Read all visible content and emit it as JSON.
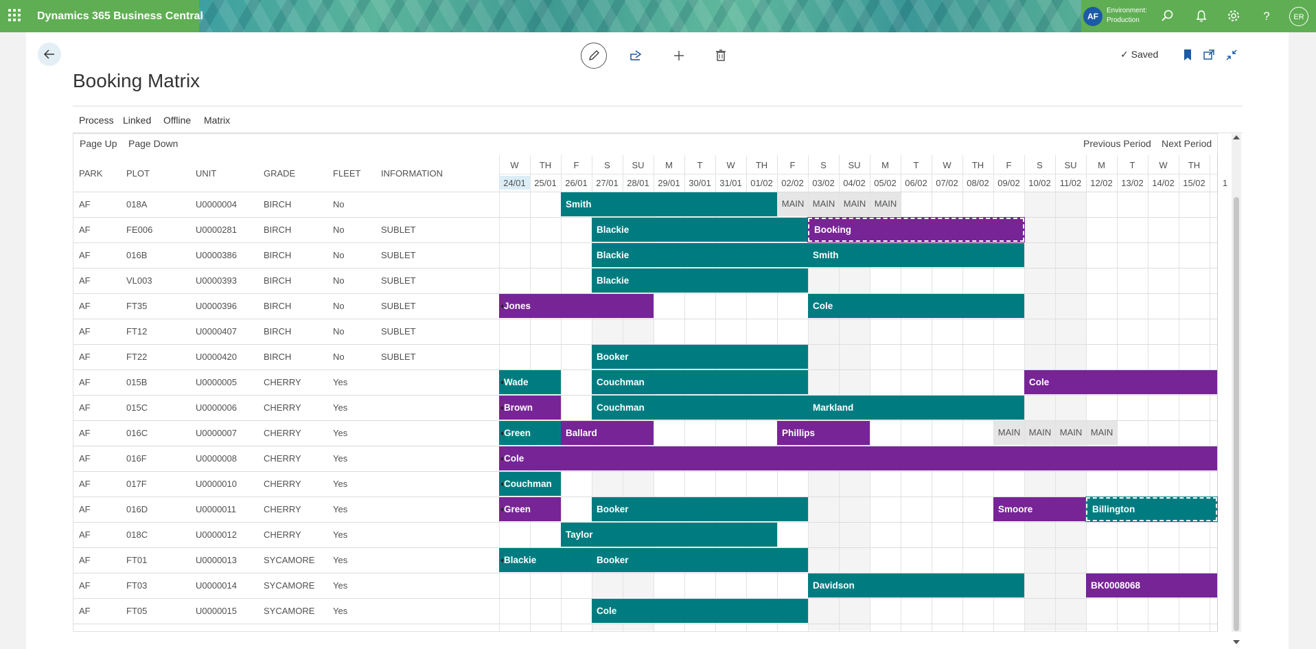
{
  "app": {
    "title": "Dynamics 365 Business Central",
    "user_initials": "AF",
    "environment_label": "Environment:",
    "environment_value": "Production",
    "profile_initials": "ER",
    "brand_color": "#5fae53"
  },
  "toolbar": {
    "saved_label": "Saved"
  },
  "page": {
    "title": "Booking Matrix"
  },
  "menu": [
    "Process",
    "Linked",
    "Offline",
    "Matrix"
  ],
  "nav": {
    "page_up": "Page Up",
    "page_down": "Page Down",
    "previous_period": "Previous Period",
    "next_period": "Next Period"
  },
  "columns": [
    "PARK",
    "PLOT",
    "UNIT",
    "GRADE",
    "FLEET",
    "INFORMATION"
  ],
  "days": [
    {
      "dow": "W",
      "date": "24/01"
    },
    {
      "dow": "TH",
      "date": "25/01"
    },
    {
      "dow": "F",
      "date": "26/01"
    },
    {
      "dow": "S",
      "date": "27/01"
    },
    {
      "dow": "SU",
      "date": "28/01"
    },
    {
      "dow": "M",
      "date": "29/01"
    },
    {
      "dow": "T",
      "date": "30/01"
    },
    {
      "dow": "W",
      "date": "31/01"
    },
    {
      "dow": "TH",
      "date": "01/02"
    },
    {
      "dow": "F",
      "date": "02/02"
    },
    {
      "dow": "S",
      "date": "03/02"
    },
    {
      "dow": "SU",
      "date": "04/02"
    },
    {
      "dow": "M",
      "date": "05/02"
    },
    {
      "dow": "T",
      "date": "06/02"
    },
    {
      "dow": "W",
      "date": "07/02"
    },
    {
      "dow": "TH",
      "date": "08/02"
    },
    {
      "dow": "F",
      "date": "09/02"
    },
    {
      "dow": "S",
      "date": "10/02"
    },
    {
      "dow": "SU",
      "date": "11/02"
    },
    {
      "dow": "M",
      "date": "12/02"
    },
    {
      "dow": "T",
      "date": "13/02"
    },
    {
      "dow": "W",
      "date": "14/02"
    },
    {
      "dow": "TH",
      "date": "15/02"
    },
    {
      "dow": "",
      "date": "1"
    }
  ],
  "rows": [
    {
      "park": "AF",
      "plot": "018A",
      "unit": "U0000004",
      "grade": "BIRCH",
      "fleet": "No",
      "info": ""
    },
    {
      "park": "AF",
      "plot": "FE006",
      "unit": "U0000281",
      "grade": "BIRCH",
      "fleet": "No",
      "info": "SUBLET"
    },
    {
      "park": "AF",
      "plot": "016B",
      "unit": "U0000386",
      "grade": "BIRCH",
      "fleet": "No",
      "info": "SUBLET"
    },
    {
      "park": "AF",
      "plot": "VL003",
      "unit": "U0000393",
      "grade": "BIRCH",
      "fleet": "No",
      "info": "SUBLET"
    },
    {
      "park": "AF",
      "plot": "FT35",
      "unit": "U0000396",
      "grade": "BIRCH",
      "fleet": "No",
      "info": "SUBLET"
    },
    {
      "park": "AF",
      "plot": "FT12",
      "unit": "U0000407",
      "grade": "BIRCH",
      "fleet": "No",
      "info": "SUBLET"
    },
    {
      "park": "AF",
      "plot": "FT22",
      "unit": "U0000420",
      "grade": "BIRCH",
      "fleet": "No",
      "info": "SUBLET"
    },
    {
      "park": "AF",
      "plot": "015B",
      "unit": "U0000005",
      "grade": "CHERRY",
      "fleet": "Yes",
      "info": ""
    },
    {
      "park": "AF",
      "plot": "015C",
      "unit": "U0000006",
      "grade": "CHERRY",
      "fleet": "Yes",
      "info": ""
    },
    {
      "park": "AF",
      "plot": "016C",
      "unit": "U0000007",
      "grade": "CHERRY",
      "fleet": "Yes",
      "info": ""
    },
    {
      "park": "AF",
      "plot": "016F",
      "unit": "U0000008",
      "grade": "CHERRY",
      "fleet": "Yes",
      "info": ""
    },
    {
      "park": "AF",
      "plot": "017F",
      "unit": "U0000010",
      "grade": "CHERRY",
      "fleet": "Yes",
      "info": ""
    },
    {
      "park": "AF",
      "plot": "016D",
      "unit": "U0000011",
      "grade": "CHERRY",
      "fleet": "Yes",
      "info": ""
    },
    {
      "park": "AF",
      "plot": "018C",
      "unit": "U0000012",
      "grade": "CHERRY",
      "fleet": "Yes",
      "info": ""
    },
    {
      "park": "AF",
      "plot": "FT01",
      "unit": "U0000013",
      "grade": "SYCAMORE",
      "fleet": "Yes",
      "info": ""
    },
    {
      "park": "AF",
      "plot": "FT03",
      "unit": "U0000014",
      "grade": "SYCAMORE",
      "fleet": "Yes",
      "info": ""
    },
    {
      "park": "AF",
      "plot": "FT05",
      "unit": "U0000015",
      "grade": "SYCAMORE",
      "fleet": "Yes",
      "info": ""
    }
  ],
  "bookings": [
    {
      "row": 0,
      "start": 2,
      "end": 9,
      "label": "Smith",
      "color": "teal"
    },
    {
      "row": 0,
      "start": 9,
      "end": 10,
      "label": "MAIN",
      "color": "maint"
    },
    {
      "row": 0,
      "start": 10,
      "end": 11,
      "label": "MAIN",
      "color": "maint"
    },
    {
      "row": 0,
      "start": 11,
      "end": 12,
      "label": "MAIN",
      "color": "maint"
    },
    {
      "row": 0,
      "start": 12,
      "end": 13,
      "label": "MAIN",
      "color": "maint"
    },
    {
      "row": 1,
      "start": 3,
      "end": 10,
      "label": "Blackie",
      "color": "teal"
    },
    {
      "row": 1,
      "start": 10,
      "end": 17,
      "label": "Booking",
      "color": "purple",
      "dashed": true
    },
    {
      "row": 2,
      "start": 3,
      "end": 10,
      "label": "Blackie",
      "color": "teal"
    },
    {
      "row": 2,
      "start": 10,
      "end": 17,
      "label": "Smith",
      "color": "teal"
    },
    {
      "row": 3,
      "start": 3,
      "end": 10,
      "label": "Blackie",
      "color": "teal"
    },
    {
      "row": 4,
      "start": 0,
      "end": 5,
      "label": "Jones",
      "color": "purple",
      "arrow": true
    },
    {
      "row": 4,
      "start": 10,
      "end": 17,
      "label": "Cole",
      "color": "teal"
    },
    {
      "row": 6,
      "start": 3,
      "end": 10,
      "label": "Booker",
      "color": "teal"
    },
    {
      "row": 7,
      "start": 0,
      "end": 2,
      "label": "Wade",
      "color": "teal",
      "arrow": true
    },
    {
      "row": 7,
      "start": 3,
      "end": 10,
      "label": "Couchman",
      "color": "teal"
    },
    {
      "row": 7,
      "start": 17,
      "end": 24,
      "label": "Cole",
      "color": "purple"
    },
    {
      "row": 8,
      "start": 0,
      "end": 2,
      "label": "Brown",
      "color": "purple",
      "arrow": true
    },
    {
      "row": 8,
      "start": 3,
      "end": 10,
      "label": "Couchman",
      "color": "teal"
    },
    {
      "row": 8,
      "start": 10,
      "end": 17,
      "label": "Markland",
      "color": "teal"
    },
    {
      "row": 9,
      "start": 0,
      "end": 2,
      "label": "Green",
      "color": "teal",
      "arrow": true
    },
    {
      "row": 9,
      "start": 2,
      "end": 5,
      "label": "Ballard",
      "color": "purple"
    },
    {
      "row": 9,
      "start": 9,
      "end": 12,
      "label": "Phillips",
      "color": "purple"
    },
    {
      "row": 9,
      "start": 16,
      "end": 17,
      "label": "MAIN",
      "color": "maint"
    },
    {
      "row": 9,
      "start": 17,
      "end": 18,
      "label": "MAIN",
      "color": "maint"
    },
    {
      "row": 9,
      "start": 18,
      "end": 19,
      "label": "MAIN",
      "color": "maint"
    },
    {
      "row": 9,
      "start": 19,
      "end": 20,
      "label": "MAIN",
      "color": "maint"
    },
    {
      "row": 10,
      "start": 0,
      "end": 24,
      "label": "Cole",
      "color": "purple",
      "arrow": true
    },
    {
      "row": 11,
      "start": 0,
      "end": 2,
      "label": "Couchman",
      "color": "teal",
      "arrow": true
    },
    {
      "row": 12,
      "start": 0,
      "end": 2,
      "label": "Green",
      "color": "purple",
      "arrow": true
    },
    {
      "row": 12,
      "start": 3,
      "end": 10,
      "label": "Booker",
      "color": "teal"
    },
    {
      "row": 12,
      "start": 16,
      "end": 19,
      "label": "Smoore",
      "color": "purple"
    },
    {
      "row": 12,
      "start": 19,
      "end": 24,
      "label": "Billington",
      "color": "teal",
      "dashed": true
    },
    {
      "row": 13,
      "start": 2,
      "end": 9,
      "label": "Taylor",
      "color": "teal"
    },
    {
      "row": 14,
      "start": 0,
      "end": 3,
      "label": "Blackie",
      "color": "teal",
      "arrow": true
    },
    {
      "row": 14,
      "start": 3,
      "end": 10,
      "label": "Booker",
      "color": "teal"
    },
    {
      "row": 15,
      "start": 10,
      "end": 17,
      "label": "Davidson",
      "color": "teal"
    },
    {
      "row": 15,
      "start": 19,
      "end": 23.7,
      "label": "BK0008068",
      "color": "purple"
    },
    {
      "row": 16,
      "start": 3,
      "end": 10,
      "label": "Cole",
      "color": "teal"
    }
  ],
  "colors": {
    "teal": "#007c80",
    "purple": "#772496",
    "maint": "#e6e6e6",
    "today": "#dbeef7"
  }
}
